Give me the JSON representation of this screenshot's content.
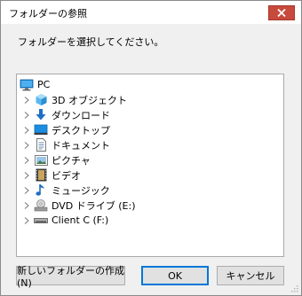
{
  "window": {
    "title": "フォルダーの参照",
    "close_icon": "close-icon"
  },
  "instruction": "フォルダーを選択してください。",
  "tree": {
    "root": {
      "label": "PC",
      "icon": "pc-icon"
    },
    "items": [
      {
        "label": "3D オブジェクト",
        "icon": "3d-objects-icon"
      },
      {
        "label": "ダウンロード",
        "icon": "download-icon"
      },
      {
        "label": "デスクトップ",
        "icon": "desktop-icon"
      },
      {
        "label": "ドキュメント",
        "icon": "document-icon"
      },
      {
        "label": "ピクチャ",
        "icon": "pictures-icon"
      },
      {
        "label": "ビデオ",
        "icon": "video-icon"
      },
      {
        "label": "ミュージック",
        "icon": "music-icon"
      },
      {
        "label": "DVD ドライブ (E:)",
        "icon": "dvd-drive-icon"
      },
      {
        "label": "Client C (F:)",
        "icon": "network-drive-icon",
        "selected": true
      }
    ]
  },
  "buttons": {
    "new_folder": "新しいフォルダーの作成(N)",
    "ok": "OK",
    "cancel": "キャンセル"
  },
  "colors": {
    "close_button": "#c74a3c",
    "selection": "#cce8ff",
    "accent": "#0078d7"
  }
}
